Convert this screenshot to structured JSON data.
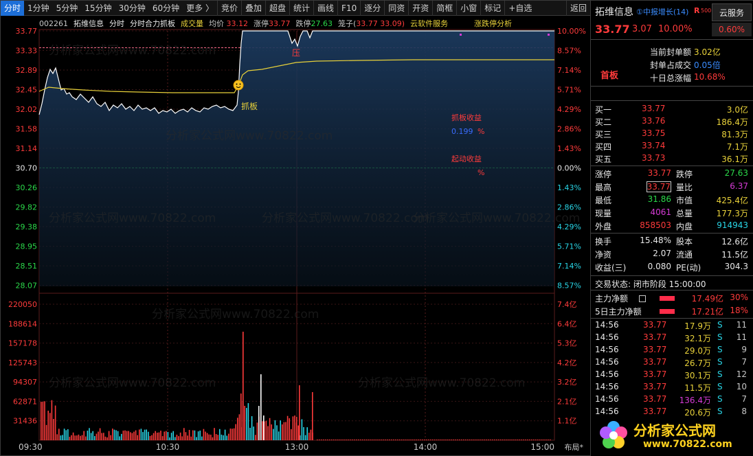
{
  "toolbar": {
    "items": [
      "分时",
      "1分钟",
      "5分钟",
      "15分钟",
      "30分钟",
      "60分钟",
      "更多 〉",
      "竞价",
      "叠加",
      "超盘",
      "统计",
      "画线",
      "F10",
      "逐分",
      "同资",
      "开资",
      "简框",
      "小窗",
      "标记",
      "+自选",
      "返回"
    ]
  },
  "header": {
    "code": "002261",
    "name": "拓维信息",
    "mode": "分时",
    "indicator": "分时合力抓板",
    "volume_label": "成交量",
    "avg_label": "均价",
    "avg_value": "33.12",
    "limit_up_label": "涨停",
    "limit_up_value": "33.77",
    "limit_down_label": "跌停",
    "limit_down_value": "27.63",
    "cage_label": "笼子(",
    "cage_values": "33.77 33.09)",
    "cloud": "云软件服务",
    "analysis": "涨跌停分析"
  },
  "chart": {
    "price_ticks": [
      "33.77",
      "33.33",
      "32.89",
      "32.45",
      "32.02",
      "31.58",
      "31.14",
      "30.70",
      "30.26",
      "29.82",
      "29.38",
      "28.95",
      "28.51",
      "28.07"
    ],
    "pct_ticks": [
      "10.00%",
      "8.57%",
      "7.14%",
      "5.71%",
      "4.29%",
      "2.86%",
      "1.43%",
      "0.00%",
      "1.43%",
      "2.86%",
      "4.29%",
      "5.71%",
      "7.14%",
      "8.57%"
    ],
    "vol_ticks": [
      "220050",
      "188614",
      "157178",
      "125743",
      "94307",
      "62871",
      "31436"
    ],
    "amt_ticks": [
      "7.4亿",
      "6.4亿",
      "5.3亿",
      "4.2亿",
      "3.2亿",
      "2.1亿",
      "1.1亿"
    ],
    "time_ticks": [
      "09:30",
      "10:30",
      "13:00",
      "14:00",
      "15:00"
    ],
    "layout_label": "布局*",
    "signal_label": "抓板",
    "pressure_label": "压",
    "profit_label": "抓板收益",
    "profit_value": "0.199",
    "profit_unit": "%",
    "start_label": "起动收益",
    "start_unit": "%",
    "watermark": "分析家公式网www.70822.com"
  },
  "panel": {
    "stock_name": "拓维信息",
    "tag": "①中报增长(14)",
    "r_label": "R",
    "r_value": "500",
    "cloud_btn": "云服务",
    "price": "33.77",
    "change": "3.07",
    "change_pct": "10.00%",
    "cloud_pct": "0.60%",
    "board_label": "首板",
    "seal_rows": [
      {
        "label": "当前封单额",
        "value": "3.02亿"
      },
      {
        "label": "封单占成交",
        "value": "0.05倍"
      },
      {
        "label": "十日总涨幅",
        "value": "10.68%"
      }
    ],
    "bids": [
      {
        "label": "买一",
        "price": "33.77",
        "vol": "3.0亿"
      },
      {
        "label": "买二",
        "price": "33.76",
        "vol": "186.4万"
      },
      {
        "label": "买三",
        "price": "33.75",
        "vol": "81.3万"
      },
      {
        "label": "买四",
        "price": "33.74",
        "vol": "7.1万"
      },
      {
        "label": "买五",
        "price": "33.73",
        "vol": "36.1万"
      }
    ],
    "stats1": [
      {
        "l1": "涨停",
        "v1": "33.77",
        "l2": "跌停",
        "v2": "27.63"
      },
      {
        "l1": "最高",
        "v1": "33.77",
        "l2": "量比",
        "v2": "6.37"
      },
      {
        "l1": "最低",
        "v1": "31.86",
        "l2": "市值",
        "v2": "425.4亿"
      },
      {
        "l1": "现量",
        "v1": "4061",
        "l2": "总量",
        "v2": "177.3万"
      },
      {
        "l1": "外盘",
        "v1": "858503",
        "l2": "内盘",
        "v2": "914943"
      }
    ],
    "stats2": [
      {
        "l1": "换手",
        "v1": "15.48%",
        "l2": "股本",
        "v2": "12.6亿"
      },
      {
        "l1": "净资",
        "v1": "2.07",
        "l2": "流通",
        "v2": "11.5亿"
      },
      {
        "l1": "收益(三)",
        "v1": "0.080",
        "l2": "PE(动)",
        "v2": "304.3"
      }
    ],
    "trade_status": "交易状态: 闭市阶段 15:00:00",
    "main_rows": [
      {
        "label": "主力净额",
        "value": "17.49亿",
        "pct": "30%"
      },
      {
        "label": "5日主力净额",
        "value": "17.21亿",
        "pct": "18%"
      }
    ],
    "ticks": [
      {
        "time": "14:56",
        "price": "33.77",
        "vol": "17.9万",
        "side": "S",
        "num": "11"
      },
      {
        "time": "14:56",
        "price": "33.77",
        "vol": "32.1万",
        "side": "S",
        "num": "11"
      },
      {
        "time": "14:56",
        "price": "33.77",
        "vol": "29.0万",
        "side": "S",
        "num": "9"
      },
      {
        "time": "14:56",
        "price": "33.77",
        "vol": "26.7万",
        "side": "S",
        "num": "7"
      },
      {
        "time": "14:56",
        "price": "33.77",
        "vol": "30.1万",
        "side": "S",
        "num": "12"
      },
      {
        "time": "14:56",
        "price": "33.77",
        "vol": "11.5万",
        "side": "S",
        "num": "10"
      },
      {
        "time": "14:56",
        "price": "33.77",
        "vol": "136.4万",
        "side": "S",
        "num": "7"
      },
      {
        "time": "14:56",
        "price": "33.77",
        "vol": "20.6万",
        "side": "S",
        "num": "8"
      },
      {
        "time": "14:",
        "price": "",
        "vol": "",
        "side": "",
        "num": ""
      },
      {
        "time": "14:",
        "price": "",
        "vol": "",
        "side": "",
        "num": ""
      },
      {
        "time": "14:",
        "price": "",
        "vol": "",
        "side": "",
        "num": ""
      }
    ],
    "logo_text": "分析家公式网",
    "logo_url": "www.70822.com"
  },
  "colors": {
    "up": "#ff3b3b",
    "down": "#2bd94a",
    "price_line": "#ffffff",
    "avg_line": "#e8d13a",
    "axis": "#8a1f1f"
  }
}
